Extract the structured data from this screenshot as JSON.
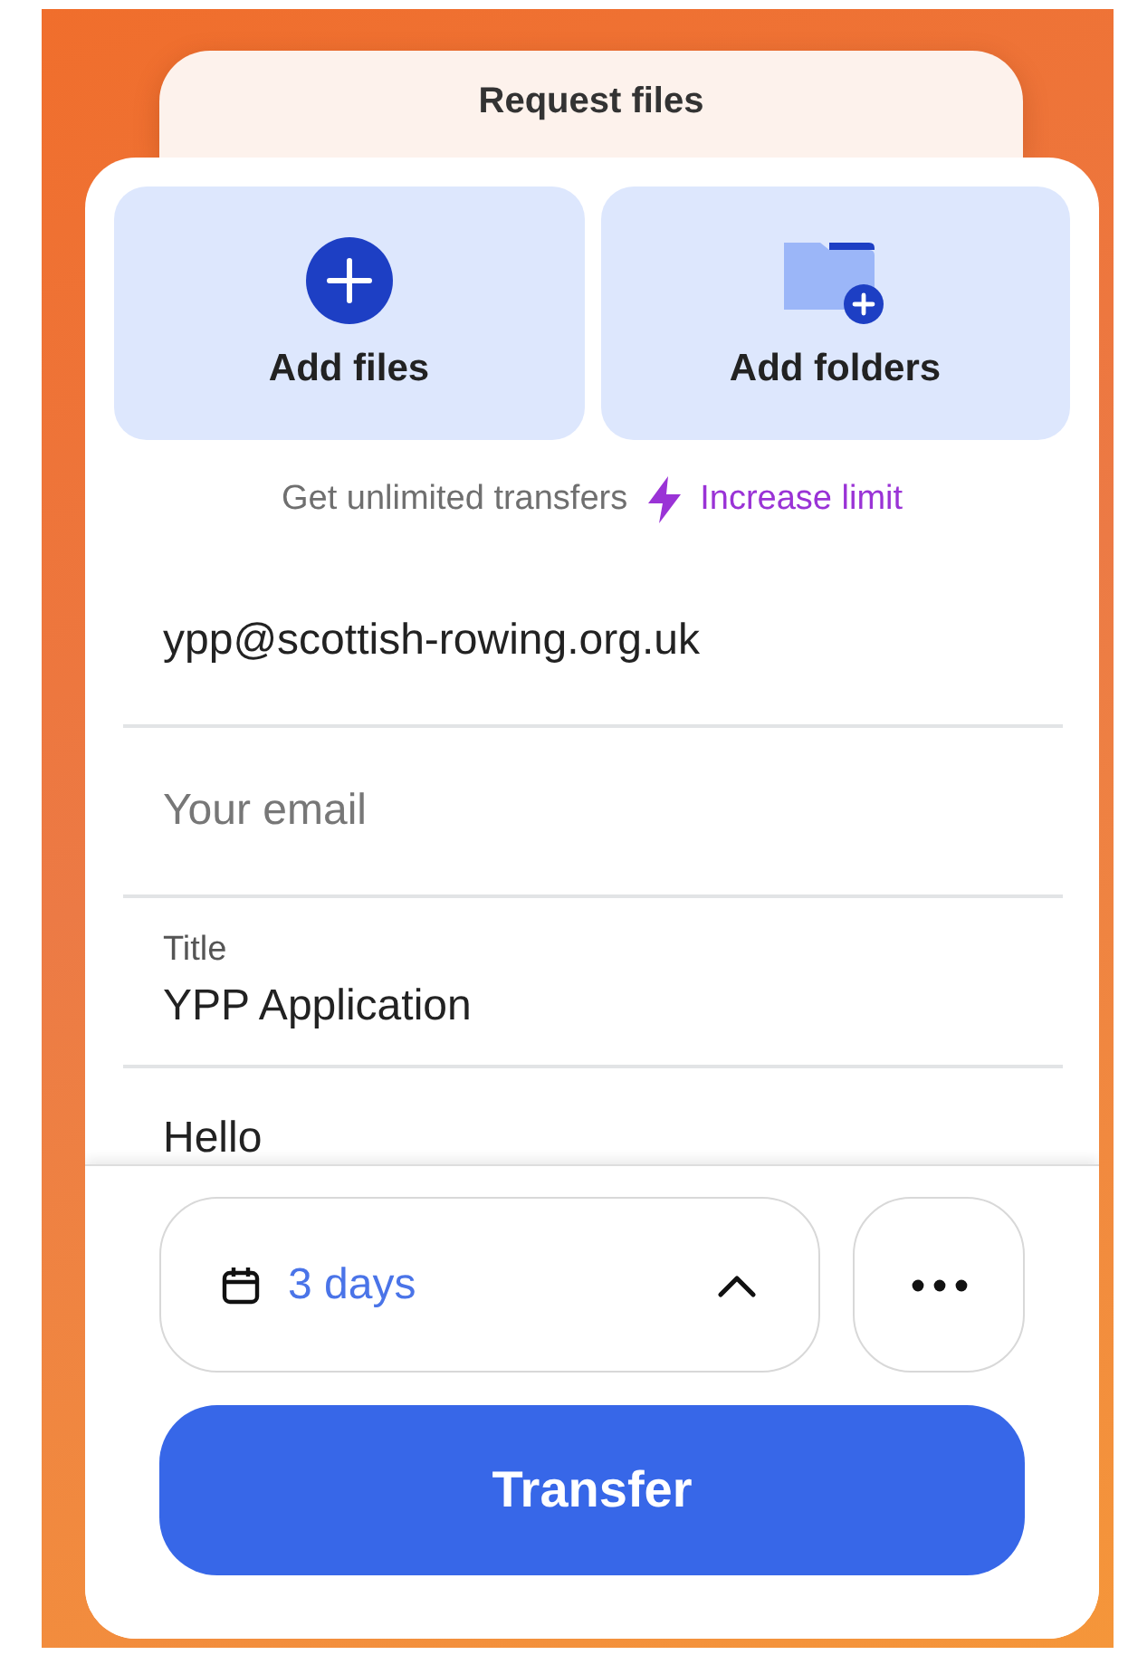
{
  "tab": {
    "label": "Request files"
  },
  "upload_tiles": [
    {
      "kind": "file",
      "label": "Add files"
    },
    {
      "kind": "folder",
      "label": "Add folders"
    }
  ],
  "promo": {
    "text": "Get unlimited transfers",
    "link": "Increase limit"
  },
  "fields": [
    {
      "kind": "plain",
      "value": "ypp@scottish-rowing.org.uk"
    },
    {
      "kind": "plain",
      "placeholder": "Your email"
    },
    {
      "kind": "labeled",
      "label": "Title",
      "value": "YPP Application"
    },
    {
      "kind": "message",
      "value": "Hello"
    }
  ],
  "expiry": {
    "value": "3 days",
    "expanded": true
  },
  "transfer_button": {
    "label": "Transfer"
  }
}
